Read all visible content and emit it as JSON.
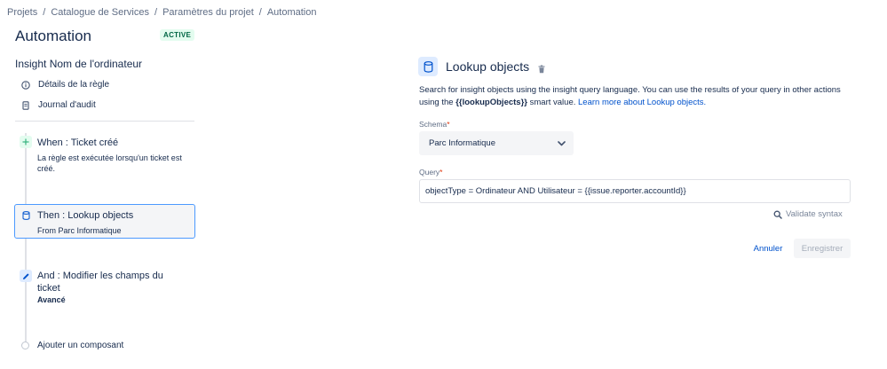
{
  "breadcrumb": [
    "Projets",
    "Catalogue de Services",
    "Paramètres du projet",
    "Automation"
  ],
  "page": {
    "title": "Automation",
    "status": "ACTIVE"
  },
  "sidebar": {
    "rule_name": "Insight Nom de l'ordinateur",
    "links": [
      {
        "label": "Détails de la règle",
        "icon": "info-icon"
      },
      {
        "label": "Journal d'audit",
        "icon": "document-icon"
      }
    ]
  },
  "steps": [
    {
      "title": "When : Ticket créé",
      "desc": "La règle est exécutée lorsqu'un ticket est créé.",
      "icon": "plus-icon",
      "color": "#36b37e"
    },
    {
      "title": "Then : Lookup objects",
      "desc": "From Parc Informatique",
      "icon": "database-icon",
      "color": "#0052cc"
    },
    {
      "title": "And : Modifier les champs du ticket",
      "desc": "Avancé",
      "icon": "pencil-icon",
      "color": "#0052cc"
    }
  ],
  "add_component": "Ajouter un composant",
  "panel": {
    "title": "Lookup objects",
    "desc_part1": "Search for insight objects using the insight query language. You can use the results of your query in other actions using the ",
    "desc_smart": "{{lookupObjects}}",
    "desc_part2": " smart value. ",
    "desc_link": "Learn more about Lookup objects.",
    "schema_label": "Schema",
    "schema_value": "Parc Informatique",
    "query_label": "Query",
    "query_value": "objectType = Ordinateur AND Utilisateur = {{issue.reporter.accountId}}",
    "validate_label": "Validate syntax",
    "cancel_label": "Annuler",
    "save_label": "Enregistrer"
  },
  "colors": {
    "accent": "#0052cc",
    "selected_border": "#4c9aff",
    "active_badge_bg": "#e3fcef",
    "active_badge_text": "#006644"
  }
}
